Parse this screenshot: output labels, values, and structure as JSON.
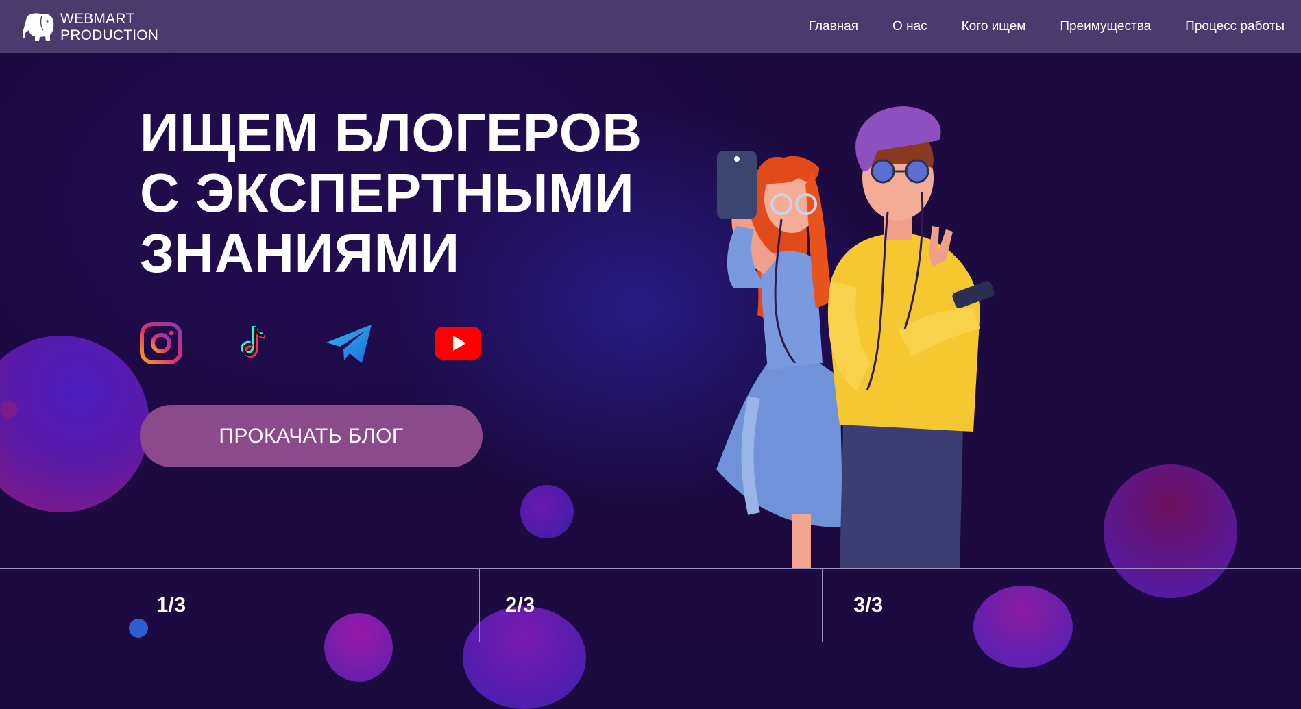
{
  "header": {
    "logo": {
      "line1": "WEBMART",
      "line2": "PRODUCTION"
    },
    "nav": [
      {
        "label": "Главная"
      },
      {
        "label": "О нас"
      },
      {
        "label": "Кого ищем"
      },
      {
        "label": "Преимущества"
      },
      {
        "label": "Процесс работы"
      }
    ]
  },
  "hero": {
    "headline": [
      "ИЩЕМ БЛОГЕРОВ",
      "С ЭКСПЕРТНЫМИ",
      "ЗНАНИЯМИ"
    ],
    "socials": [
      "instagram-icon",
      "tiktok-icon",
      "telegram-icon",
      "youtube-icon"
    ],
    "cta_label": "ПРОКАЧАТЬ БЛОГ"
  },
  "slides": [
    "1/3",
    "2/3",
    "3/3"
  ],
  "colors": {
    "header_bg": "#4b3a6e",
    "page_bg": "#1c0a40",
    "cta_bg": "#8a4a8c",
    "divider": "#9c92b8"
  }
}
